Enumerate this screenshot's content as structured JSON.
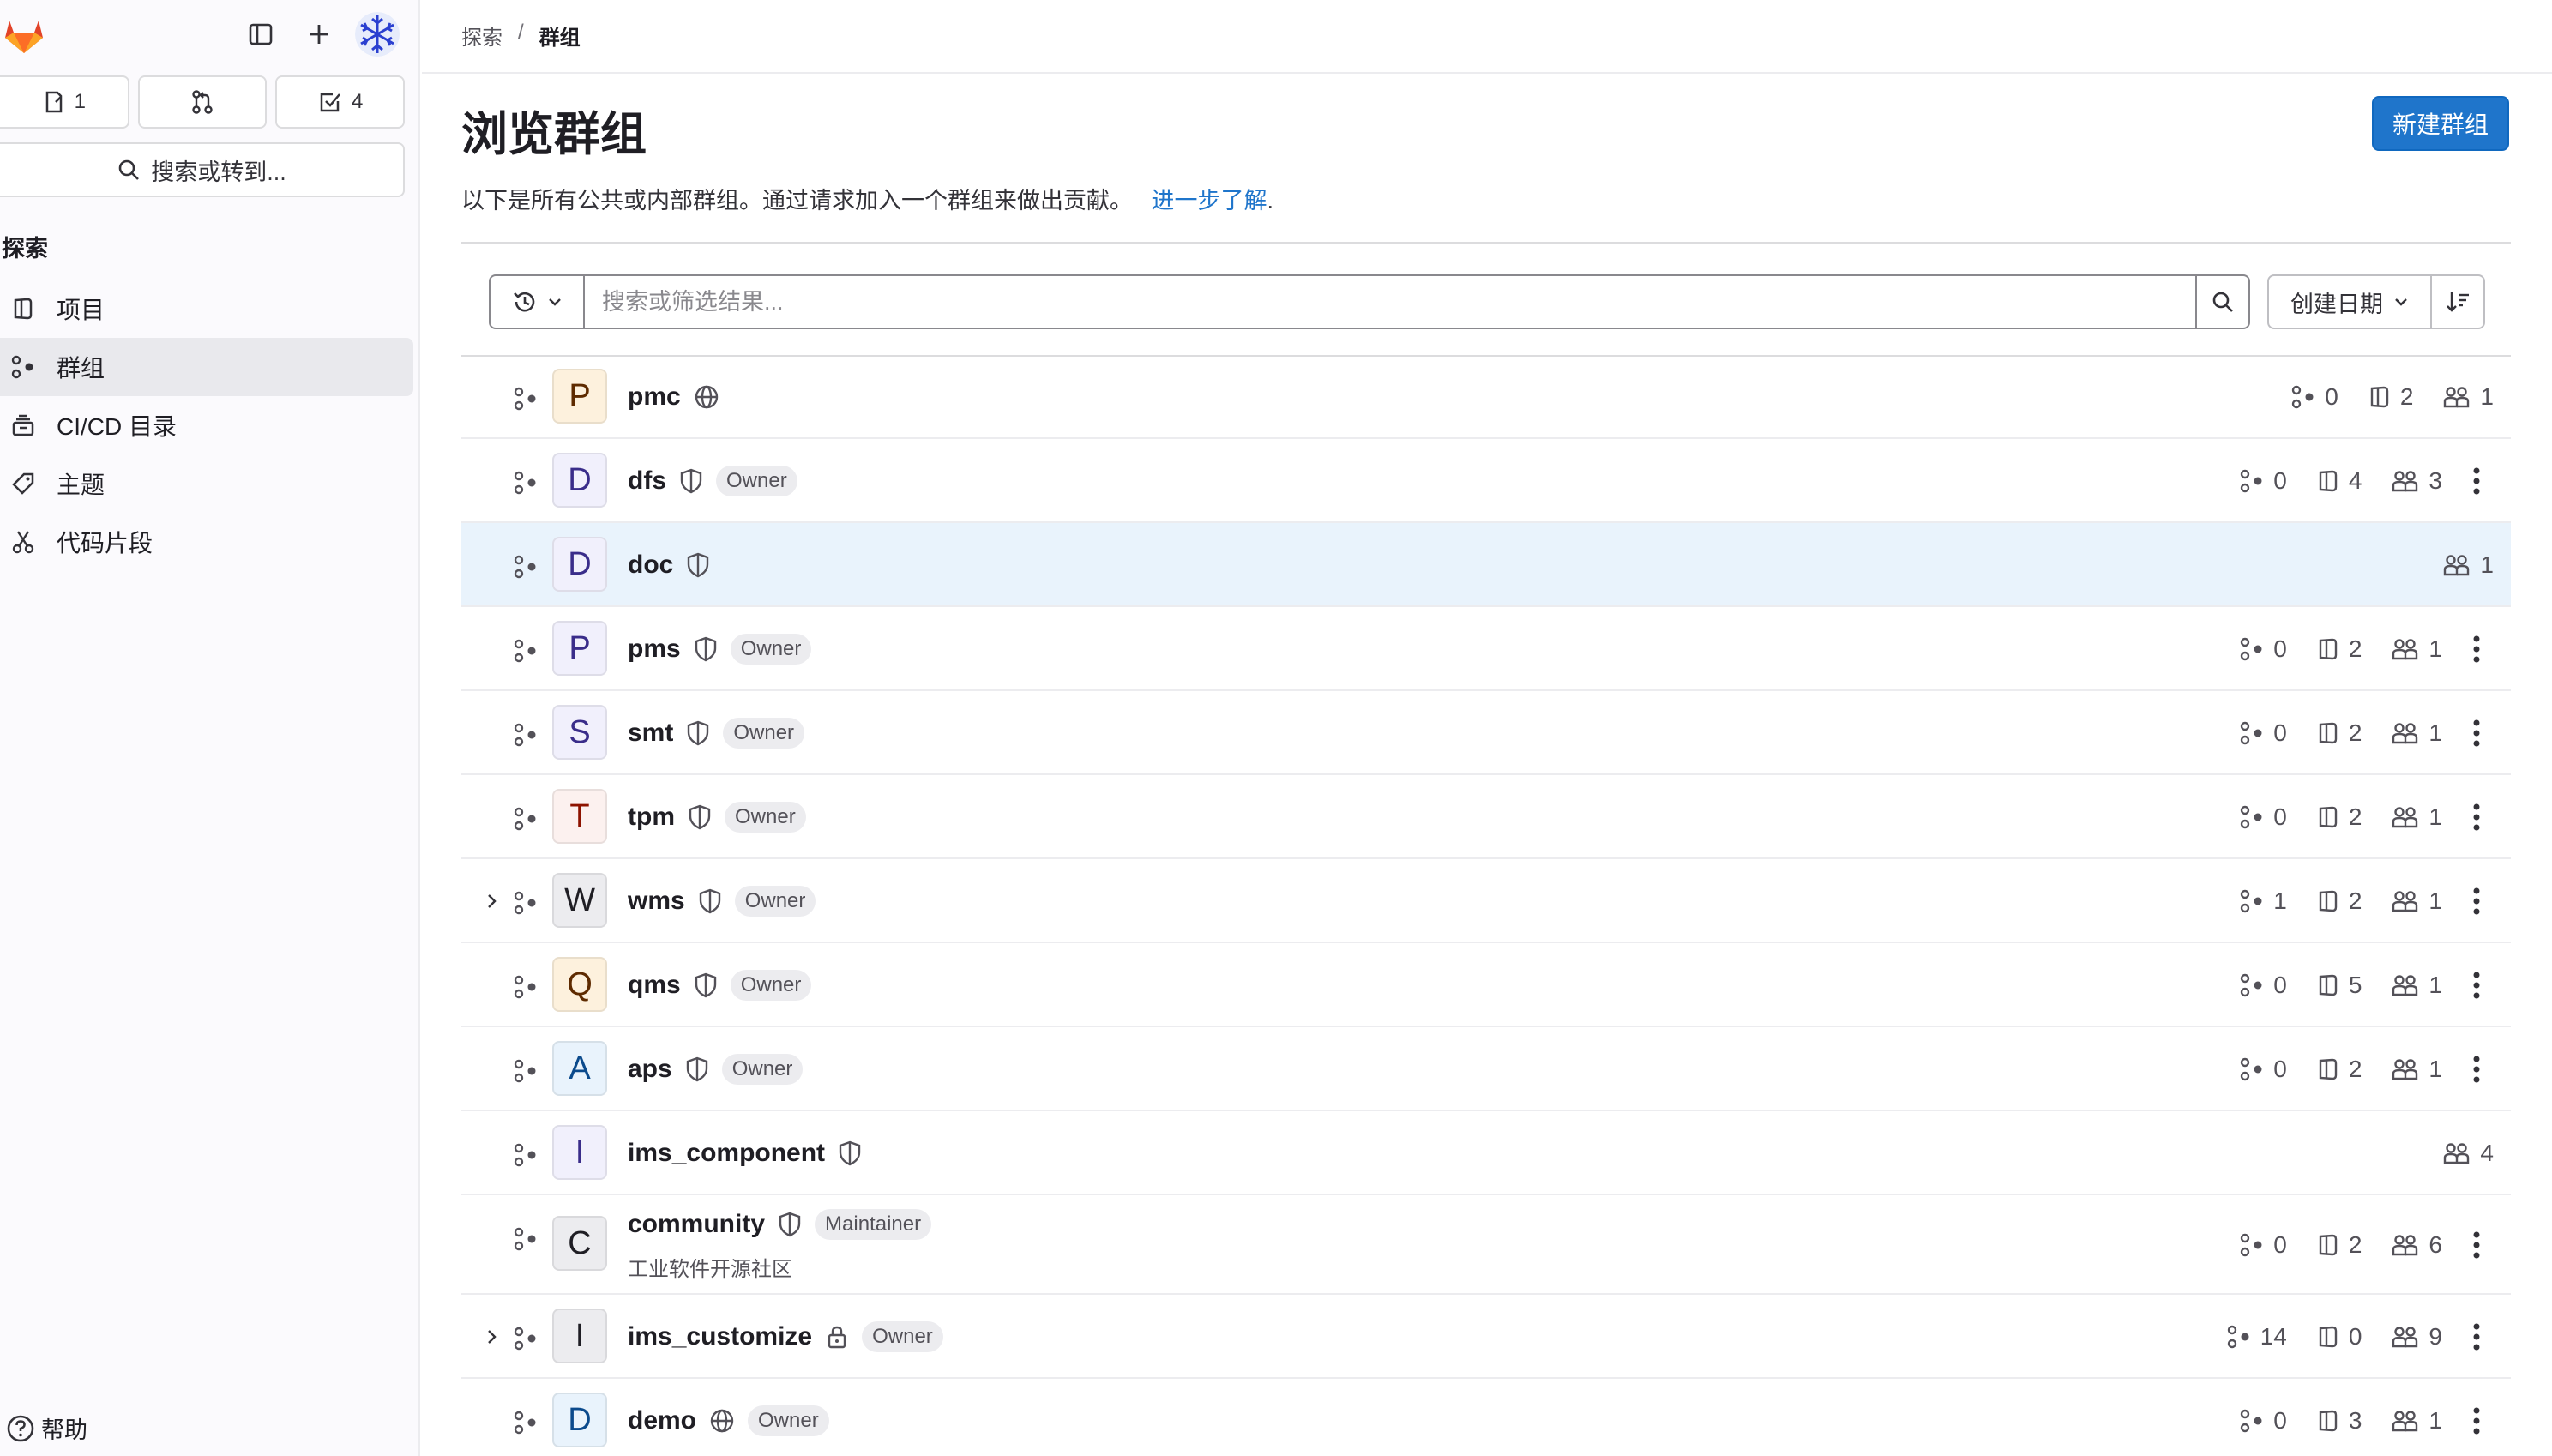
{
  "sidebar": {
    "counters": [
      {
        "icon": "issues-icon",
        "value": "1"
      },
      {
        "icon": "merge-request-icon",
        "value": ""
      },
      {
        "icon": "todo-icon",
        "value": "4"
      }
    ],
    "search_label": "搜索或转到...",
    "section_title": "探索",
    "nav": [
      {
        "label": "项目",
        "icon": "project-icon"
      },
      {
        "label": "群组",
        "icon": "group-icon",
        "active": true
      },
      {
        "label": "CI/CD 目录",
        "icon": "catalog-icon"
      },
      {
        "label": "主题",
        "icon": "label-icon"
      },
      {
        "label": "代码片段",
        "icon": "snippet-icon"
      }
    ],
    "help_label": "帮助"
  },
  "breadcrumb": {
    "parent": "探索",
    "current": "群组"
  },
  "page": {
    "title": "浏览群组",
    "new_group_button": "新建群组",
    "description": "以下是所有公共或内部群组。通过请求加入一个群组来做出贡献。",
    "learn_more": "进一步了解",
    "learn_more_suffix": "."
  },
  "filter": {
    "search_placeholder": "搜索或筛选结果...",
    "sort_label": "创建日期"
  },
  "colors": {
    "accent": "#1f75cb",
    "highlight_row": "#e9f3fc"
  },
  "groups": [
    {
      "letter": "P",
      "name": "pmc",
      "visibility": "public",
      "badge": "",
      "subgroups": "0",
      "projects": "2",
      "members": "1",
      "kebab": false,
      "expandable": false,
      "avatar_bg": "#fdf1dd",
      "avatar_fg": "#5e2b00"
    },
    {
      "letter": "D",
      "name": "dfs",
      "visibility": "internal",
      "badge": "Owner",
      "subgroups": "0",
      "projects": "4",
      "members": "3",
      "kebab": true,
      "expandable": false,
      "avatar_bg": "#f1f0fc",
      "avatar_fg": "#3a2d8a"
    },
    {
      "letter": "D",
      "name": "doc",
      "visibility": "internal",
      "badge": "",
      "subgroups": "",
      "projects": "",
      "members": "1",
      "kebab": false,
      "expandable": false,
      "highlight": true,
      "avatar_bg": "#f1f0fc",
      "avatar_fg": "#3a2d8a"
    },
    {
      "letter": "P",
      "name": "pms",
      "visibility": "internal",
      "badge": "Owner",
      "subgroups": "0",
      "projects": "2",
      "members": "1",
      "kebab": true,
      "expandable": false,
      "avatar_bg": "#f1f0fc",
      "avatar_fg": "#3a2d8a"
    },
    {
      "letter": "S",
      "name": "smt",
      "visibility": "internal",
      "badge": "Owner",
      "subgroups": "0",
      "projects": "2",
      "members": "1",
      "kebab": true,
      "expandable": false,
      "avatar_bg": "#f1f0fc",
      "avatar_fg": "#3a2d8a"
    },
    {
      "letter": "T",
      "name": "tpm",
      "visibility": "internal",
      "badge": "Owner",
      "subgroups": "0",
      "projects": "2",
      "members": "1",
      "kebab": true,
      "expandable": false,
      "avatar_bg": "#fcf1ef",
      "avatar_fg": "#8d1300"
    },
    {
      "letter": "W",
      "name": "wms",
      "visibility": "internal",
      "badge": "Owner",
      "subgroups": "1",
      "projects": "2",
      "members": "1",
      "kebab": true,
      "expandable": true,
      "avatar_bg": "#ececef",
      "avatar_fg": "#1f1e24"
    },
    {
      "letter": "Q",
      "name": "qms",
      "visibility": "internal",
      "badge": "Owner",
      "subgroups": "0",
      "projects": "5",
      "members": "1",
      "kebab": true,
      "expandable": false,
      "avatar_bg": "#fdf1dd",
      "avatar_fg": "#5e2b00"
    },
    {
      "letter": "A",
      "name": "aps",
      "visibility": "internal",
      "badge": "Owner",
      "subgroups": "0",
      "projects": "2",
      "members": "1",
      "kebab": true,
      "expandable": false,
      "avatar_bg": "#e9f3fc",
      "avatar_fg": "#0b4a8c"
    },
    {
      "letter": "I",
      "name": "ims_component",
      "visibility": "internal",
      "badge": "",
      "subgroups": "",
      "projects": "",
      "members": "4",
      "kebab": false,
      "expandable": false,
      "avatar_bg": "#f1f0fc",
      "avatar_fg": "#3a2d8a"
    },
    {
      "letter": "C",
      "name": "community",
      "visibility": "internal",
      "badge": "Maintainer",
      "subtitle": "工业软件开源社区",
      "subgroups": "0",
      "projects": "2",
      "members": "6",
      "kebab": true,
      "expandable": false,
      "avatar_bg": "#ececef",
      "avatar_fg": "#1f1e24"
    },
    {
      "letter": "I",
      "name": "ims_customize",
      "visibility": "private",
      "badge": "Owner",
      "subgroups": "14",
      "projects": "0",
      "members": "9",
      "kebab": true,
      "expandable": true,
      "avatar_bg": "#ececef",
      "avatar_fg": "#1f1e24"
    },
    {
      "letter": "D",
      "name": "demo",
      "visibility": "public",
      "badge": "Owner",
      "subgroups": "0",
      "projects": "3",
      "members": "1",
      "kebab": true,
      "expandable": false,
      "avatar_bg": "#e9f3fc",
      "avatar_fg": "#0b4a8c"
    }
  ]
}
